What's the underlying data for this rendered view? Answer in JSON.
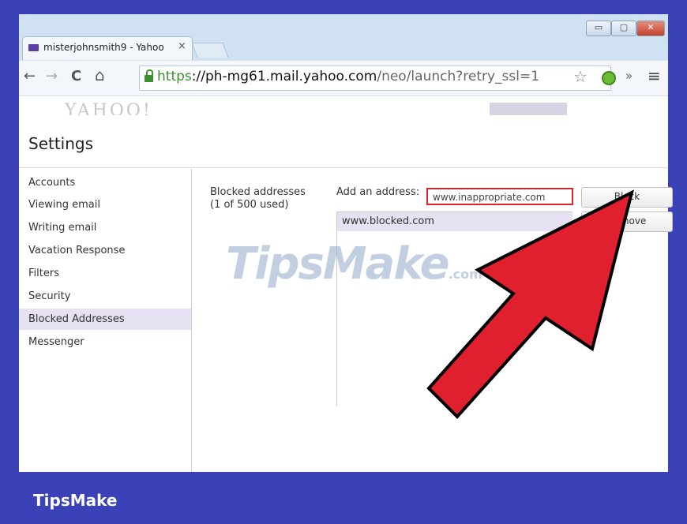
{
  "browser": {
    "tab_title": "misterjohnsmith9 - Yahoo",
    "tab_close": "×",
    "window_controls": [
      "▭",
      "▢",
      "✕"
    ],
    "nav": {
      "back": "←",
      "forward": "→",
      "reload": "C",
      "home": "⌂"
    },
    "url": {
      "scheme": "https",
      "host": "://ph-mg61.mail.yahoo.com",
      "path": "/neo/launch?retry_ssl=1"
    },
    "star_icon": "☆",
    "overflow": "»",
    "menu_icon": "≡"
  },
  "yahoo": {
    "logo": "YAHOO!"
  },
  "page": {
    "title": "Settings",
    "sidebar": [
      {
        "label": "Accounts",
        "active": false
      },
      {
        "label": "Viewing email",
        "active": false
      },
      {
        "label": "Writing email",
        "active": false
      },
      {
        "label": "Vacation Response",
        "active": false
      },
      {
        "label": "Filters",
        "active": false
      },
      {
        "label": "Security",
        "active": false
      },
      {
        "label": "Blocked Addresses",
        "active": true
      },
      {
        "label": "Messenger",
        "active": false
      }
    ],
    "blocked": {
      "heading": "Blocked addresses",
      "usage": "(1 of 500 used)",
      "add_label": "Add an address:",
      "input_value": "www.inappropriate.com",
      "block_button": "Block",
      "remove_button": "Remove",
      "list": [
        "www.blocked.com"
      ]
    }
  },
  "watermark": {
    "text": "TipsMake",
    "suffix": ".com"
  },
  "brand": "TipsMake",
  "colors": {
    "frame": "#3b42b8",
    "highlight": "#d42828",
    "arrow": "#e0202e",
    "selected": "#e6e1f3"
  }
}
